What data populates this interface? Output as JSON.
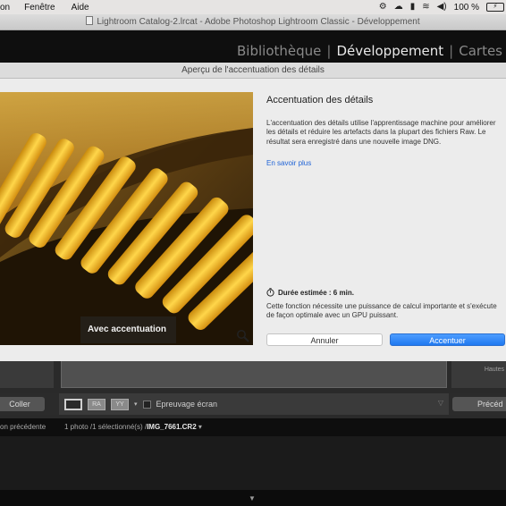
{
  "menubar": {
    "items": [
      "on",
      "Fenêtre",
      "Aide"
    ],
    "battery": "100 %"
  },
  "window": {
    "title": "Lightroom Catalog-2.lrcat - Adobe Photoshop Lightroom Classic - Développement"
  },
  "modules": {
    "items": [
      "Bibliothèque",
      "Développement",
      "Cartes"
    ],
    "active": "Développement"
  },
  "dialog": {
    "title": "Aperçu de l'accentuation des détails",
    "preview_label": "Avec accentuation",
    "heading": "Accentuation des détails",
    "description": "L'accentuation des détails utilise l'apprentissage machine pour améliorer les détails et réduire les artefacts dans la plupart des fichiers Raw. Le résultat sera enregistré dans une nouvelle image DNG.",
    "learn_more": "En savoir plus",
    "duration_label": "Durée estimée : 6 min.",
    "requirement": "Cette fonction nécessite une puissance de calcul importante et s'exécute de façon optimale avec un GPU puissant.",
    "cancel": "Annuler",
    "accept": "Accentuer"
  },
  "right_panel": {
    "label": "Hautes"
  },
  "toolbar": {
    "paste": "Coller",
    "tool_ra": "RA",
    "tool_yy": "YY",
    "soft_proof": "Epreuvage écran",
    "previous": "Précéd"
  },
  "status": {
    "previous_label": "on précédente",
    "count_prefix": "1 photo /1 sélectionné(s) /",
    "filename": "IMG_7661.CR2"
  },
  "colors": {
    "accent_blue": "#1f78f0",
    "link_blue": "#1f63d6"
  }
}
